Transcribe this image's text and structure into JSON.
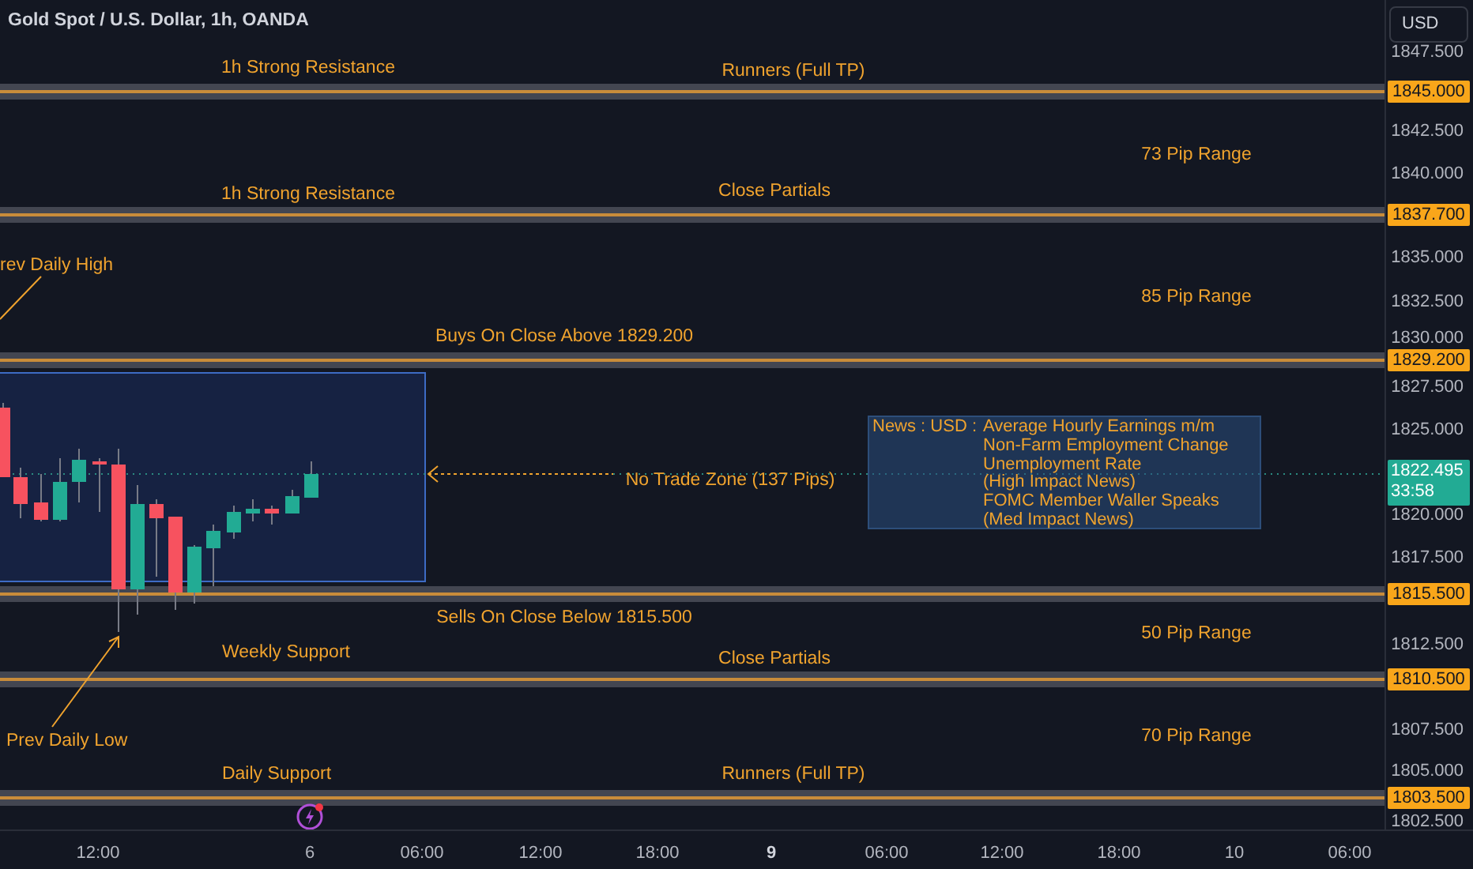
{
  "title": "Gold Spot / U.S. Dollar, 1h, OANDA",
  "currency_button": "USD",
  "levels": [
    {
      "price": "1845.000"
    },
    {
      "price": "1837.700"
    },
    {
      "price": "1829.200"
    },
    {
      "price": "1815.500"
    },
    {
      "price": "1810.500"
    },
    {
      "price": "1803.500"
    }
  ],
  "annotations": [
    "1h Strong Resistance",
    "Runners (Full TP)",
    "73 Pip Range",
    "Close Partials",
    "1h Strong Resistance",
    "rev Daily High",
    "85 Pip Range",
    "Buys On Close Above 1829.200",
    "Sells On Close Below 1815.500",
    "50 Pip Range",
    "Weekly Support",
    "Close Partials",
    "Prev Daily Low",
    "70 Pip Range",
    "Daily Support",
    "Runners (Full TP)"
  ],
  "no_trade_zone": "No Trade Zone (137 Pips)",
  "news": {
    "heading": "News : USD :",
    "lines": [
      "Average Hourly Earnings m/m",
      "Non-Farm Employment Change",
      "Unemployment Rate",
      "(High Impact News)",
      "FOMC Member Waller Speaks",
      "(Med Impact News)"
    ]
  },
  "price_axis": [
    "1847.500",
    "1842.500",
    "1840.000",
    "1835.000",
    "1832.500",
    "1830.000",
    "1827.500",
    "1825.000",
    "1820.000",
    "1817.500",
    "1812.500",
    "1807.500",
    "1805.000",
    "1802.500"
  ],
  "current_price": {
    "price": "1822.495",
    "countdown": "33:58"
  },
  "time_axis": [
    {
      "label": "12:00",
      "bold": false
    },
    {
      "label": "6",
      "bold": false
    },
    {
      "label": "06:00",
      "bold": false
    },
    {
      "label": "12:00",
      "bold": false
    },
    {
      "label": "18:00",
      "bold": false
    },
    {
      "label": "9",
      "bold": true
    },
    {
      "label": "06:00",
      "bold": false
    },
    {
      "label": "12:00",
      "bold": false
    },
    {
      "label": "18:00",
      "bold": false
    },
    {
      "label": "10",
      "bold": false
    },
    {
      "label": "06:00",
      "bold": false
    }
  ]
}
